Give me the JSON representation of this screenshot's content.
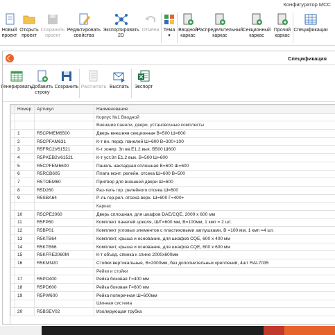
{
  "app": {
    "title": "Конфигуратор МСС"
  },
  "ribbon": {
    "new_project": "Новый проект",
    "open_project": "Открыть проект",
    "save_project": "Сохранить проект",
    "edit_properties": "Редактировать свойства",
    "export_2d": "Экспортировать 2D",
    "undo": "Отмена",
    "theme": "Тема",
    "input_frame": "Вводной каркас",
    "distribution_frame": "Распределительный каркас",
    "section_frame": "Секционный каркас",
    "other_frame": "Прочий каркас",
    "specification": "Спецификации"
  },
  "panel": {
    "title": "Спецификация"
  },
  "toolbar": {
    "generate": "Генерировать",
    "add_row": "Добавить строку",
    "save": "Сохранить",
    "calculate": "Рассчитать",
    "send": "Выслать",
    "export": "Экспорт"
  },
  "colors": {
    "accent": "#e8632b",
    "disabled": "#a8a8a8",
    "excel_green": "#1e7145"
  },
  "table": {
    "headers": [
      "Номер",
      "Артикул",
      "Наименование"
    ],
    "rows": [
      [
        "",
        "",
        "Корпус №1 Вводной"
      ],
      [
        "",
        "",
        "Внешние панели, двери, установочные комплекты"
      ],
      [
        "1",
        "R5CPMEM6500",
        "Дверь внешняя секционная В=500 Ш=600"
      ],
      [
        "2",
        "R5CPFAM631",
        "К-т вн. перф. панелей Ш=600 В=300+100"
      ],
      [
        "3",
        "R5FRC2V61521",
        "К-т зонир. 3п вв.Е1.2 вык. В500 Ш600"
      ],
      [
        "4",
        "R5PKEB2V61521",
        "К-т уст.3п Е1.2 вык. В=500 Ш=600"
      ],
      [
        "5",
        "R5CPFEM6600",
        "Панель накладная сплошная В=600 Ш=600"
      ],
      [
        "6",
        "R5RCB605",
        "Плата монт. релейн. отсека Ш=600 В=500"
      ],
      [
        "7",
        "R5TOEM60",
        "Притвор для внешней двери Ш=600"
      ],
      [
        "8",
        "R5D260",
        "Раз-тель гор. релейного отсека Ш=600"
      ],
      [
        "9",
        "R5SBA64",
        "Р-ль гор.рел. отсека верх. Ш=600 Г=400+"
      ],
      [
        "",
        "",
        "Каркас"
      ],
      [
        "10",
        "R5CPE2060",
        "Дверь сплошная, для шкафов DAE/CQE, 2000 x 600 мм"
      ],
      [
        "11",
        "R5FP60",
        "Комплект панелей цоколя, Ш/Г=600 мм, В=100мм, 1 кмп = 2 шт."
      ],
      [
        "12",
        "R5BP01",
        "Комплект угловых элементов с пластиковыми заглушками, В =100 мм, 1 кмп =4 шт."
      ],
      [
        "13",
        "R5KTB64",
        "Комплект, крыша и основание, для шкафов CQE, 600 x 400 мм"
      ],
      [
        "14",
        "R5KTB66",
        "Комплект, крыша и основание, для шкафов CQE, 600 x 600 мм"
      ],
      [
        "15",
        "R5KFRE2060M",
        "К-т объед. спинка к спине 2000x600мм"
      ],
      [
        "16",
        "R5KMN20",
        "Стойки вертикальные, В=2000мм, без дополнительных креплений, 4шт RAL7035"
      ],
      [
        "",
        "",
        "Рейки и стойки"
      ],
      [
        "17",
        "R5PD400",
        "Рейка боковая Г=400 мм"
      ],
      [
        "18",
        "R5PD600",
        "Рейка боковая Г=600 мм"
      ],
      [
        "19",
        "R5PW600",
        "Рейка поперечная Ш=600мм"
      ],
      [
        "",
        "",
        "Шинная система"
      ],
      [
        "20",
        "R5BSEV02",
        "Изолирующая трубка"
      ]
    ]
  }
}
